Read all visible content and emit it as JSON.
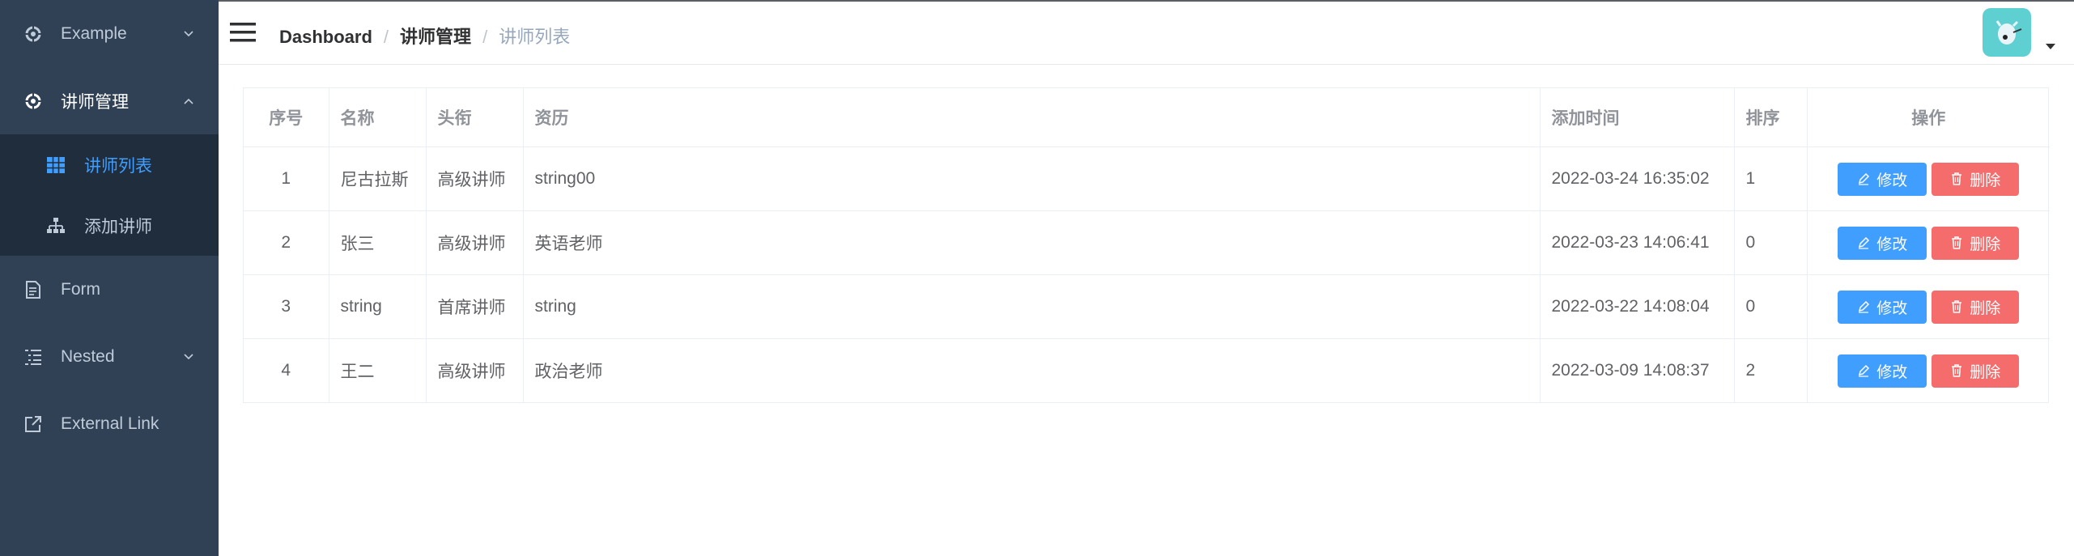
{
  "sidebar": {
    "items": [
      {
        "label": "Example",
        "icon": "example-icon"
      },
      {
        "label": "讲师管理",
        "icon": "teacher-management-icon"
      },
      {
        "label": "讲师列表",
        "icon": "grid-table-icon"
      },
      {
        "label": "添加讲师",
        "icon": "tree-icon"
      },
      {
        "label": "Form",
        "icon": "form-icon"
      },
      {
        "label": "Nested",
        "icon": "nested-icon"
      },
      {
        "label": "External Link",
        "icon": "external-link-icon"
      }
    ]
  },
  "breadcrumb": [
    "Dashboard",
    "讲师管理",
    "讲师列表"
  ],
  "table": {
    "columns": [
      "序号",
      "名称",
      "头衔",
      "资历",
      "添加时间",
      "排序",
      "操作"
    ],
    "rows": [
      {
        "index": "1",
        "name": "尼古拉斯",
        "title": "高级讲师",
        "intro": "string00",
        "time": "2022-03-24 16:35:02",
        "sort": "1"
      },
      {
        "index": "2",
        "name": "张三",
        "title": "高级讲师",
        "intro": "英语老师",
        "time": "2022-03-23 14:06:41",
        "sort": "0"
      },
      {
        "index": "3",
        "name": "string",
        "title": "首席讲师",
        "intro": "string",
        "time": "2022-03-22 14:08:04",
        "sort": "0"
      },
      {
        "index": "4",
        "name": "王二",
        "title": "高级讲师",
        "intro": "政治老师",
        "time": "2022-03-09 14:08:37",
        "sort": "2"
      }
    ],
    "edit_label": "修改",
    "delete_label": "删除"
  },
  "colors": {
    "sidebar_bg": "#304156",
    "submenu_bg": "#1f2d3d",
    "sidebar_text": "#bfcbd9",
    "active": "#409eff",
    "danger": "#f56c6c",
    "avatar_bg": "#5fd0d2"
  }
}
